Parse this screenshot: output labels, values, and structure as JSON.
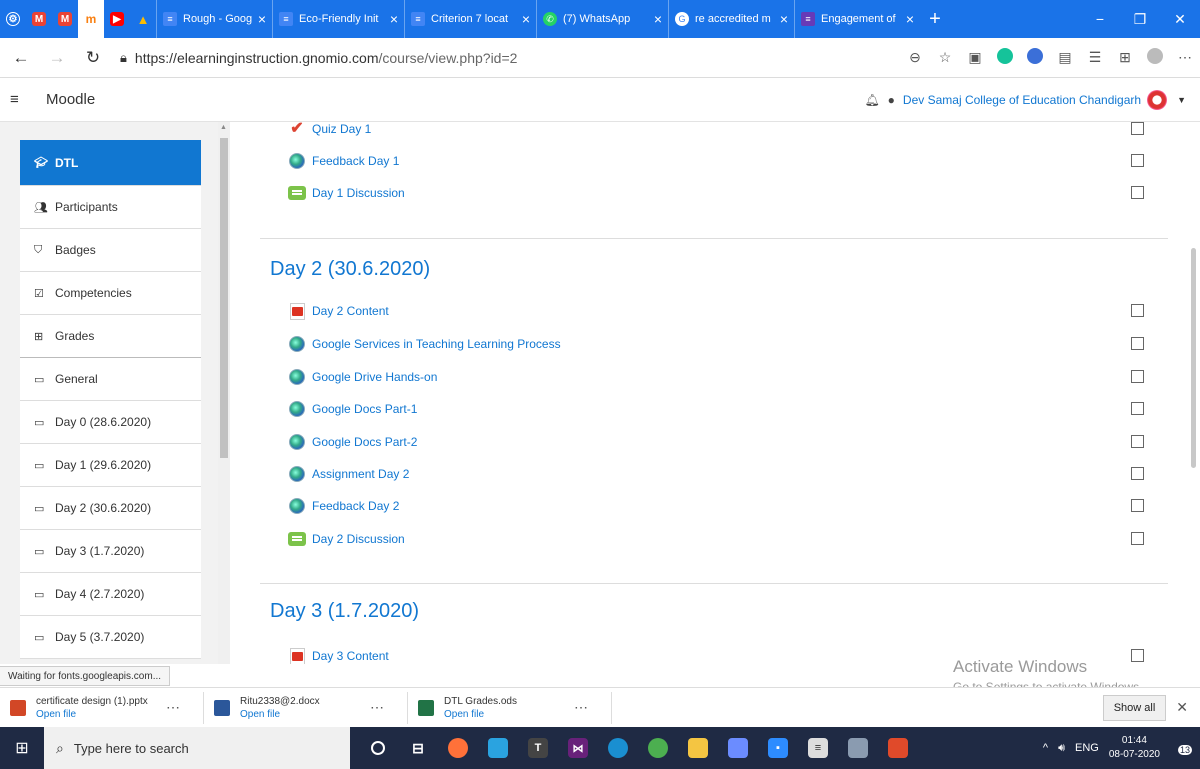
{
  "browser": {
    "tabs": [
      {
        "title": "Rough - Google",
        "icon": "docs-icon",
        "color": "#4285f4"
      },
      {
        "title": "Eco-Friendly Init",
        "icon": "docs-icon",
        "color": "#4285f4"
      },
      {
        "title": "Criterion 7 locat",
        "icon": "docs-icon",
        "color": "#4285f4"
      },
      {
        "title": "(7) WhatsApp",
        "icon": "whatsapp-icon",
        "color": "#25d366"
      },
      {
        "title": "re accredited m",
        "icon": "google-icon",
        "color": "#ffffff"
      },
      {
        "title": "Engagement of",
        "icon": "forms-icon",
        "color": "#673ab7"
      }
    ],
    "url_host": "https://elearninginstruction.gnomio.com",
    "url_path": "/course/view.php?id=2",
    "status_text": "Waiting for fonts.googleapis.com..."
  },
  "moodle": {
    "brand": "Moodle",
    "user_name": "Dev Samaj College of Education Chandigarh"
  },
  "drawer": {
    "items": [
      {
        "label": "DTL",
        "icon": "graduation-cap-icon",
        "active": true
      },
      {
        "label": "Participants",
        "icon": "users-icon"
      },
      {
        "label": "Badges",
        "icon": "shield-icon"
      },
      {
        "label": "Competencies",
        "icon": "check-square-icon"
      },
      {
        "label": "Grades",
        "icon": "table-icon"
      },
      {
        "label": "General",
        "icon": "folder-icon"
      },
      {
        "label": "Day 0 (28.6.2020)",
        "icon": "folder-icon"
      },
      {
        "label": "Day 1 (29.6.2020)",
        "icon": "folder-icon"
      },
      {
        "label": "Day 2 (30.6.2020)",
        "icon": "folder-icon"
      },
      {
        "label": "Day 3 (1.7.2020)",
        "icon": "folder-icon"
      },
      {
        "label": "Day 4 (2.7.2020)",
        "icon": "folder-icon"
      },
      {
        "label": "Day 5 (3.7.2020)",
        "icon": "folder-icon"
      }
    ]
  },
  "course": {
    "day1_activities": [
      {
        "label": "Quiz Day 1",
        "type": "quiz"
      },
      {
        "label": "Feedback Day 1",
        "type": "feedback"
      },
      {
        "label": "Day 1 Discussion",
        "type": "forum"
      }
    ],
    "day2_title": "Day 2 (30.6.2020)",
    "day2_activities": [
      {
        "label": "Day 2 Content",
        "type": "pdf"
      },
      {
        "label": "Google Services in Teaching Learning Process",
        "type": "url"
      },
      {
        "label": "Google Drive Hands-on",
        "type": "url"
      },
      {
        "label": "Google Docs Part-1",
        "type": "url"
      },
      {
        "label": "Google Docs Part-2",
        "type": "url"
      },
      {
        "label": "Assignment Day 2",
        "type": "url"
      },
      {
        "label": "Feedback Day 2",
        "type": "feedback"
      },
      {
        "label": "Day 2 Discussion",
        "type": "forum"
      }
    ],
    "day3_title": "Day 3 (1.7.2020)",
    "day3_activities": [
      {
        "label": "Day 3 Content",
        "type": "pdf"
      }
    ]
  },
  "watermark": {
    "line1": "Activate Windows",
    "line2": "Go to Settings to activate Windows."
  },
  "downloads": {
    "items": [
      {
        "name": "certificate design (1).pptx",
        "action": "Open file",
        "color": "#d24726"
      },
      {
        "name": "Ritu2338@2.docx",
        "action": "Open file",
        "color": "#2b579a"
      },
      {
        "name": "DTL Grades.ods",
        "action": "Open file",
        "color": "#217346"
      }
    ],
    "show_all": "Show all"
  },
  "taskbar": {
    "search_placeholder": "Type here to search",
    "language": "ENG",
    "time": "01:44",
    "date": "08-07-2020",
    "notification_count": "13"
  }
}
